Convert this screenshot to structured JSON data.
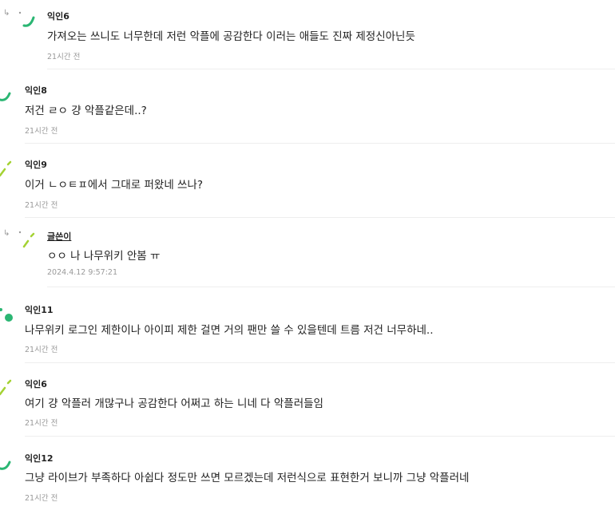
{
  "comments": [
    {
      "author": "익인6",
      "content": "가져오는 쓰니도 너무한데 저런 악플에 공감한다 이러는 애들도 진짜 제정신아닌듯",
      "time": "21시간 전",
      "reply": true
    },
    {
      "author": "익인8",
      "content": "저건 ㄹㅇ 걍 악플같은데..?",
      "time": "21시간 전",
      "reply": false
    },
    {
      "author": "익인9",
      "content": "이거 ㄴㅇㅌㅍ에서 그대로 퍼왔네 쓰나?",
      "time": "21시간 전",
      "reply": false
    },
    {
      "author": "글쓴이",
      "content": "ㅇㅇ 나 나무위키 안봄 ㅠ",
      "time": "2024.4.12 9:57:21",
      "reply": true,
      "op": true
    },
    {
      "author": "익인11",
      "content": "나무위키 로그인 제한이나 아이피 제한 걸면 거의 팬만 쓸 수 있을텐데 트름 저건 너무하네..",
      "time": "21시간 전",
      "reply": false
    },
    {
      "author": "익인6",
      "content": "여기 걍 악플러 개많구나 공감한다 어쩌고 하는 니네 다 악플러들임",
      "time": "21시간 전",
      "reply": false
    },
    {
      "author": "익인12",
      "content": "그냥 라이브가 부족하다 아쉽다 정도만 쓰면 모르겠는데 저런식으로 표현한거 보니까 그냥 악플러네",
      "time": "21시간 전",
      "reply": false
    }
  ],
  "icons": {
    "reply_arrow": "↳",
    "reply_arrow_icon": "reply-arrow-icon"
  },
  "colors": {
    "green": "#2bb673",
    "lime": "#a4d233",
    "meta": "#999999",
    "divider": "#eeeeee"
  }
}
